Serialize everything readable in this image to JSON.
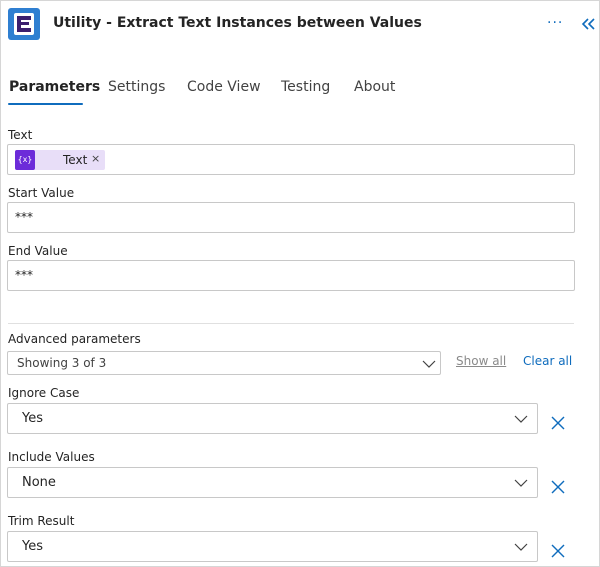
{
  "header": {
    "title": "Utility - Extract Text Instances between Values",
    "more_label": "···",
    "app_icon": "encodian-logo-icon",
    "collapse_icon": "double-chevron-left-icon"
  },
  "tabs": [
    {
      "label": "Parameters"
    },
    {
      "label": "Settings"
    },
    {
      "label": "Code View"
    },
    {
      "label": "Testing"
    },
    {
      "label": "About"
    }
  ],
  "fields": {
    "text": {
      "label": "Text",
      "token_label": "Text",
      "token_icon_text": "{x}",
      "token_remove": "×"
    },
    "start_value": {
      "label": "Start Value",
      "value": "***"
    },
    "end_value": {
      "label": "End Value",
      "value": "***"
    }
  },
  "advanced": {
    "label": "Advanced parameters",
    "selected": "Showing 3 of 3",
    "show_all": "Show all",
    "clear_all": "Clear all"
  },
  "ignore_case": {
    "label": "Ignore Case",
    "value": "Yes"
  },
  "include_values": {
    "label": "Include Values",
    "value": "None"
  },
  "trim_result": {
    "label": "Trim Result",
    "value": "Yes"
  },
  "colors": {
    "accent": "#0f6cbd",
    "token_bg": "#e8def8",
    "token_icon": "#6c2bd9",
    "app_icon": "#2f7fd1"
  }
}
